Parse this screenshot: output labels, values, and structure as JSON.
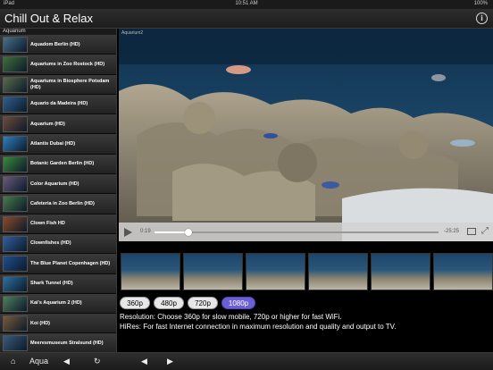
{
  "status": {
    "left": "iPad",
    "time": "10:51 AM",
    "right": "100%"
  },
  "app": {
    "title": "Chill Out & Relax",
    "info_icon": "info-icon"
  },
  "sidebar": {
    "section": "Aquarium",
    "items": [
      {
        "label": "Aquadom Berlin (HD)",
        "thumb": "#4a6f8a"
      },
      {
        "label": "Aquariums in Zoo Rostock (HD)",
        "thumb": "#3f6e3a"
      },
      {
        "label": "Aquariums in Biosphere Potsdam (HD)",
        "thumb": "#5a6a4a"
      },
      {
        "label": "Aquario da Madeira (HD)",
        "thumb": "#2f5f8f"
      },
      {
        "label": "Aquarium (HD)",
        "thumb": "#6f4a3a"
      },
      {
        "label": "Atlantis Dubai (HD)",
        "thumb": "#2f7fbf"
      },
      {
        "label": "Botanic Garden Berlin (HD)",
        "thumb": "#3a8a3a"
      },
      {
        "label": "Color Aquarium (HD)",
        "thumb": "#6a5a7a"
      },
      {
        "label": "Cafeteria in Zoo Berlin (HD)",
        "thumb": "#4a7a4a"
      },
      {
        "label": "Clown Fish HD",
        "thumb": "#8a4a2a"
      },
      {
        "label": "Clownfishes (HD)",
        "thumb": "#2f5f9f"
      },
      {
        "label": "The Blue Planet Copenhagen (HD)",
        "thumb": "#1f4f8f"
      },
      {
        "label": "Shark Tunnel (HD)",
        "thumb": "#2f6fa0"
      },
      {
        "label": "Kai's Aquarium 2 (HD)",
        "thumb": "#4f7f5f"
      },
      {
        "label": "Koi (HD)",
        "thumb": "#7a5a3a"
      },
      {
        "label": "Meeresmuseum Stralsund (HD)",
        "thumb": "#3a5a7a"
      }
    ]
  },
  "video": {
    "caption": "Aquarium2",
    "elapsed": "0:19",
    "remaining": "-25:25",
    "progress": 0.12
  },
  "resolution": {
    "options": [
      "360p",
      "480p",
      "720p",
      "1080p"
    ],
    "selected": "1080p",
    "line1": "Resolution: Choose 360p for slow mobile, 720p or higher for fast WiFi.",
    "line2": "HiRes: For fast Internet connection in maximum resolution and quality and output to TV."
  },
  "toolbar": {
    "home_icon": "home-icon",
    "category": "Aqua",
    "prev_label": "◀",
    "refresh_label": "↻",
    "back_label": "◀",
    "forward_label": "▶"
  },
  "colors": {
    "accent": "#6b5fd6",
    "water": "#0e2a45",
    "rock": "#8a8a7a"
  }
}
